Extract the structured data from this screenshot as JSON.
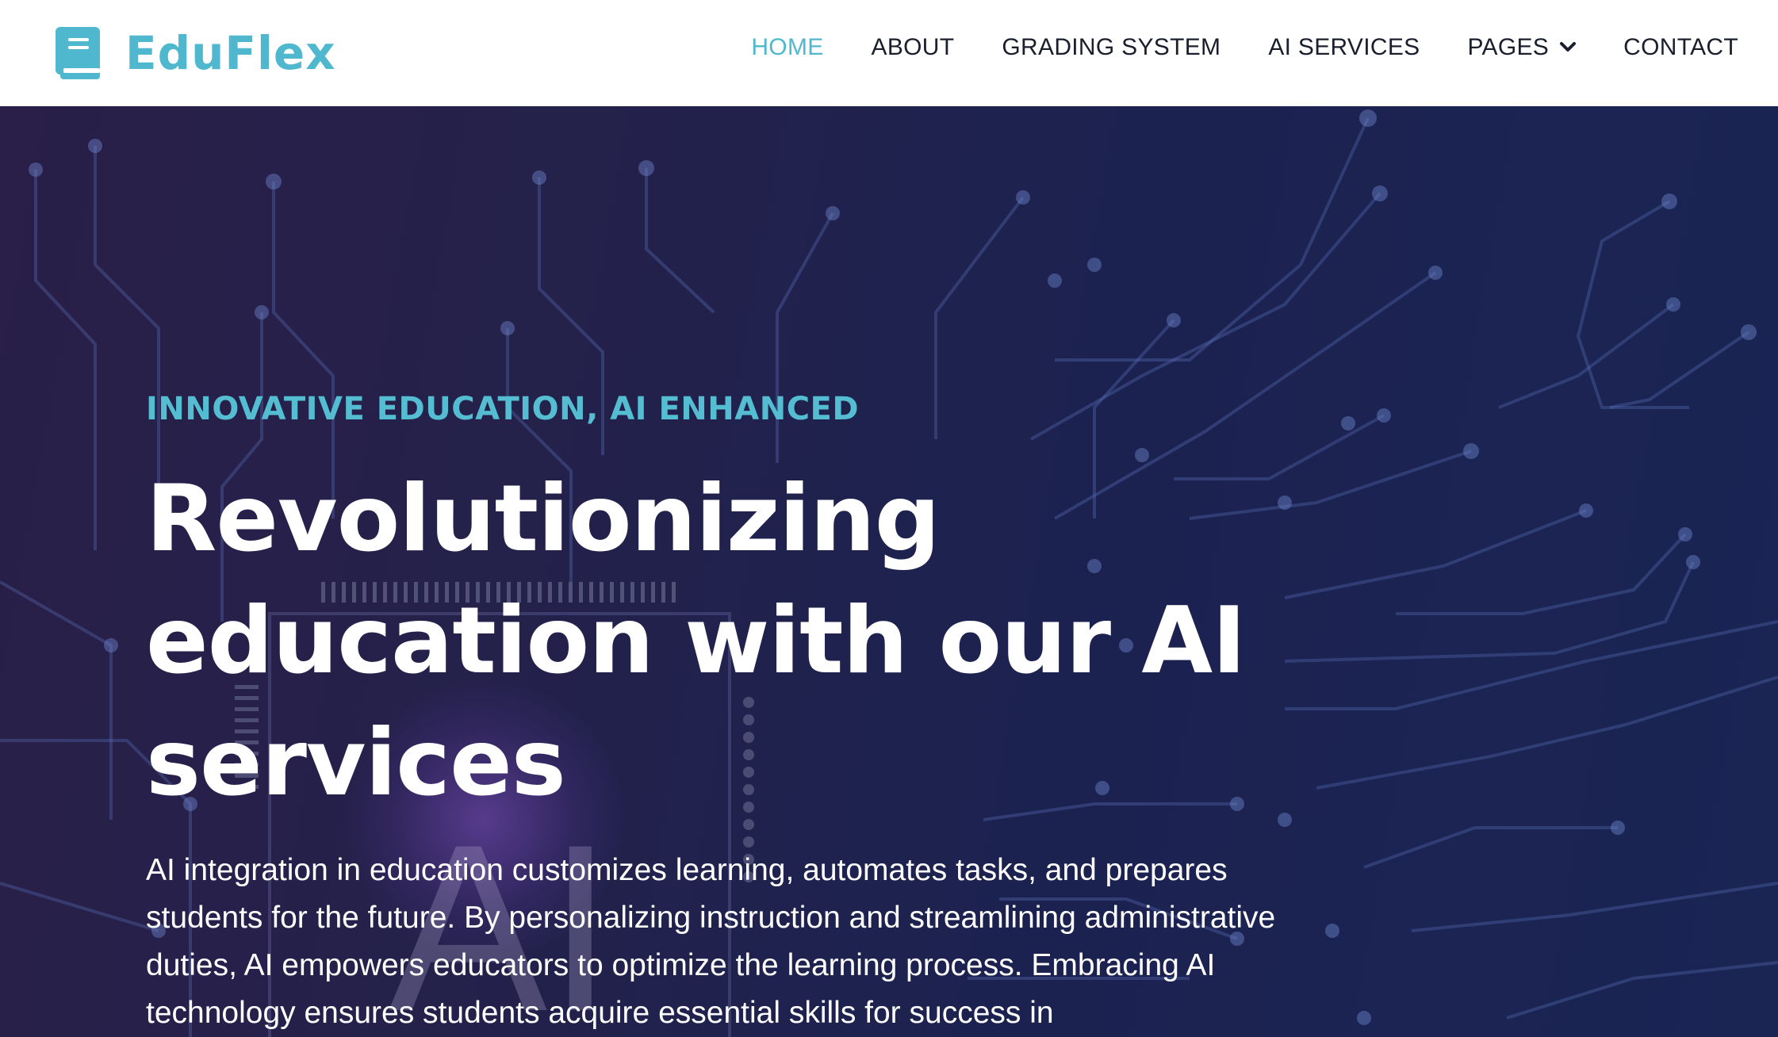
{
  "brand": {
    "name": "EduFlex",
    "icon": "book-icon",
    "color": "#4fb8ce"
  },
  "nav": {
    "items": [
      {
        "label": "HOME",
        "active": true
      },
      {
        "label": "ABOUT",
        "active": false
      },
      {
        "label": "GRADING SYSTEM",
        "active": false
      },
      {
        "label": "AI SERVICES",
        "active": false
      },
      {
        "label": "PAGES",
        "active": false,
        "icon": "chevron-down-icon"
      },
      {
        "label": "CONTACT",
        "active": false
      }
    ]
  },
  "hero": {
    "eyebrow": "INNOVATIVE EDUCATION, AI ENHANCED",
    "title": "Revolutionizing education with our AI services",
    "description": "AI integration in education customizes learning, automates tasks, and prepares students for the future. By personalizing instruction and streamlining administrative duties, AI empowers educators to optimize the learning process. Embracing AI technology ensures students acquire essential skills for success in",
    "background_text": "AI",
    "accent_color": "#55bdd2"
  }
}
